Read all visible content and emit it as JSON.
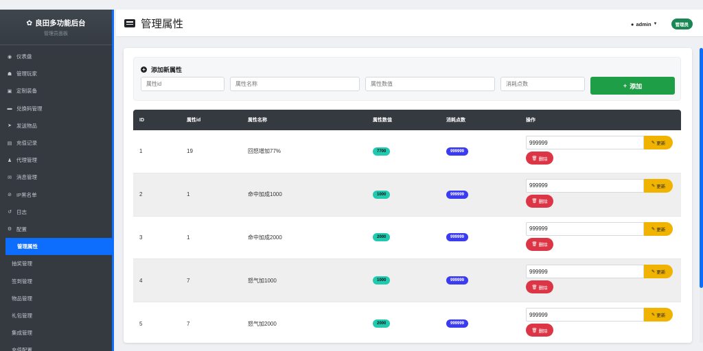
{
  "sidebar": {
    "brand_title": "良田多功能后台",
    "brand_sub": "管理员面板",
    "items": [
      {
        "label": "仪表盘",
        "icon": "dashboard-icon",
        "glyph": "◉"
      },
      {
        "label": "管理玩家",
        "icon": "users-icon",
        "glyph": "☗"
      },
      {
        "label": "定制装备",
        "icon": "gift-icon",
        "glyph": "▣"
      },
      {
        "label": "兑换码管理",
        "icon": "card-icon",
        "glyph": "▬"
      },
      {
        "label": "发送物品",
        "icon": "send-icon",
        "glyph": "➤"
      },
      {
        "label": "充值记录",
        "icon": "file-icon",
        "glyph": "▤"
      },
      {
        "label": "代理管理",
        "icon": "user-tie-icon",
        "glyph": "♟"
      },
      {
        "label": "消息管理",
        "icon": "comments-icon",
        "glyph": "✉"
      },
      {
        "label": "IP黑名单",
        "icon": "ban-icon",
        "glyph": "⊘"
      },
      {
        "label": "日志",
        "icon": "history-icon",
        "glyph": "↺"
      },
      {
        "label": "配置",
        "icon": "cogs-icon",
        "glyph": "⚙"
      }
    ],
    "sub_items": [
      {
        "label": "管理属性",
        "active": true
      },
      {
        "label": "抽奖管理",
        "active": false
      },
      {
        "label": "签到管理",
        "active": false
      },
      {
        "label": "物品管理",
        "active": false
      },
      {
        "label": "礼包管理",
        "active": false
      },
      {
        "label": "集成管理",
        "active": false
      },
      {
        "label": "充值配置",
        "active": false
      }
    ]
  },
  "header": {
    "title": "管理属性",
    "username": "admin",
    "role": "管理员"
  },
  "add_form": {
    "title": "添加新属性",
    "attr_id_placeholder": "属性id",
    "attr_name_placeholder": "属性名称",
    "attr_value_placeholder": "属性数值",
    "cost_placeholder": "消耗点数",
    "add_label": "添加"
  },
  "table": {
    "headers": [
      "ID",
      "属性id",
      "属性名称",
      "属性数值",
      "消耗点数",
      "操作"
    ],
    "update_label": "更新",
    "delete_label": "删除",
    "rows": [
      {
        "id": "1",
        "attr_id": "19",
        "name": "回怒增加77%",
        "value": "7700",
        "cost": "999999",
        "input": "999999"
      },
      {
        "id": "2",
        "attr_id": "1",
        "name": "命中加成1000",
        "value": "1000",
        "cost": "999999",
        "input": "999999"
      },
      {
        "id": "3",
        "attr_id": "1",
        "name": "命中加成2000",
        "value": "2000",
        "cost": "999999",
        "input": "999999"
      },
      {
        "id": "4",
        "attr_id": "7",
        "name": "怒气加1000",
        "value": "1000",
        "cost": "999999",
        "input": "999999"
      },
      {
        "id": "5",
        "attr_id": "7",
        "name": "怒气加2000",
        "value": "2000",
        "cost": "999999",
        "input": "999999"
      }
    ]
  },
  "colors": {
    "sidebar_bg": "#343a40",
    "active_blue": "#0d6efd",
    "add_green": "#1e9e46",
    "update_yellow": "#f0b400",
    "delete_red": "#dc3545",
    "value_teal": "#20c9b0",
    "cost_indigo": "#3b3bf0",
    "role_green": "#198754"
  }
}
